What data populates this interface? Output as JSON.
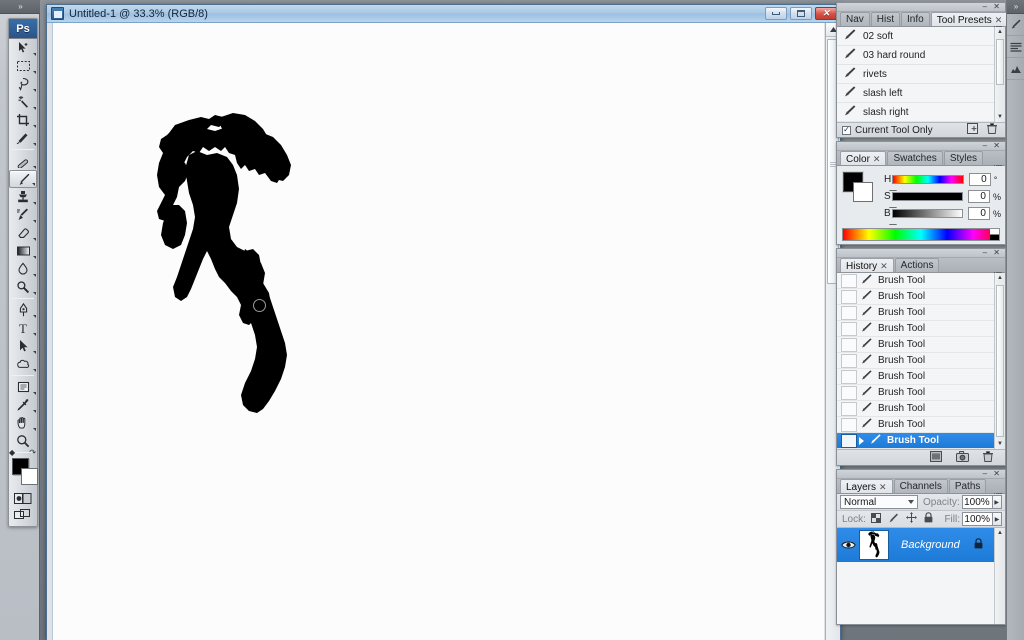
{
  "app": {
    "name": "Adobe Photoshop",
    "logo_text": "Ps",
    "left_rail_collapse": "»",
    "right_rail_collapse": "»"
  },
  "document": {
    "title": "Untitled-1 @ 33.3% (RGB/8)",
    "zoom": "33.3%",
    "color_mode": "RGB/8",
    "window_buttons": {
      "minimize": "–",
      "maximize": "□",
      "close": "✕"
    },
    "canvas_background": "#ffffff",
    "artwork_color": "#000000",
    "artwork_description": "black silhouette of running armored figure"
  },
  "toolbox": {
    "tools": [
      {
        "name": "move-tool",
        "label": "Move Tool",
        "selected": false
      },
      {
        "name": "rectangular-marquee-tool",
        "label": "Rectangular Marquee Tool",
        "selected": false
      },
      {
        "name": "lasso-tool",
        "label": "Lasso Tool",
        "selected": false
      },
      {
        "name": "magic-wand-tool",
        "label": "Magic Wand Tool",
        "selected": false
      },
      {
        "name": "crop-tool",
        "label": "Crop Tool",
        "selected": false
      },
      {
        "name": "slice-tool",
        "label": "Slice Tool",
        "selected": false
      },
      {
        "name": "healing-brush-tool",
        "label": "Spot Healing Brush Tool",
        "selected": false
      },
      {
        "name": "brush-tool",
        "label": "Brush Tool",
        "selected": true
      },
      {
        "name": "clone-stamp-tool",
        "label": "Clone Stamp Tool",
        "selected": false
      },
      {
        "name": "history-brush-tool",
        "label": "History Brush Tool",
        "selected": false
      },
      {
        "name": "eraser-tool",
        "label": "Eraser Tool",
        "selected": false
      },
      {
        "name": "gradient-tool",
        "label": "Gradient Tool",
        "selected": false
      },
      {
        "name": "blur-tool",
        "label": "Blur Tool",
        "selected": false
      },
      {
        "name": "dodge-tool",
        "label": "Dodge Tool",
        "selected": false
      },
      {
        "name": "pen-tool",
        "label": "Pen Tool",
        "selected": false
      },
      {
        "name": "type-tool",
        "label": "Horizontal Type Tool",
        "selected": false
      },
      {
        "name": "path-selection-tool",
        "label": "Path Selection Tool",
        "selected": false
      },
      {
        "name": "custom-shape-tool",
        "label": "Custom Shape Tool",
        "selected": false
      },
      {
        "name": "notes-tool",
        "label": "Notes Tool",
        "selected": false
      },
      {
        "name": "eyedropper-tool",
        "label": "Eyedropper Tool",
        "selected": false
      },
      {
        "name": "hand-tool",
        "label": "Hand Tool",
        "selected": false
      },
      {
        "name": "zoom-tool",
        "label": "Zoom Tool",
        "selected": false
      }
    ],
    "foreground_color": "#000000",
    "background_color": "#ffffff",
    "quick_mask_label": "Edit in Quick Mask Mode",
    "screen_mode_label": "Change Screen Mode"
  },
  "tool_presets_panel": {
    "tabs": [
      {
        "label": "Nav",
        "active": false
      },
      {
        "label": "Hist",
        "active": false
      },
      {
        "label": "Info",
        "active": false
      },
      {
        "label": "Tool Presets",
        "active": true,
        "closable": true
      }
    ],
    "presets": [
      {
        "label": "02 soft"
      },
      {
        "label": "03 hard round"
      },
      {
        "label": "rivets"
      },
      {
        "label": "slash left"
      },
      {
        "label": "slash right"
      }
    ],
    "current_tool_only": {
      "label": "Current Tool Only",
      "checked": true,
      "check_glyph": "✓"
    },
    "footer_icons": [
      {
        "name": "new-tool-preset-icon"
      },
      {
        "name": "delete-tool-preset-icon"
      }
    ]
  },
  "color_panel": {
    "tabs": [
      {
        "label": "Color",
        "active": true,
        "closable": true
      },
      {
        "label": "Swatches",
        "active": false
      },
      {
        "label": "Styles",
        "active": false
      }
    ],
    "foreground_color": "#000000",
    "background_color": "#ffffff",
    "sliders": [
      {
        "label": "H",
        "value": "0",
        "unit": "°"
      },
      {
        "label": "S",
        "value": "0",
        "unit": "%"
      },
      {
        "label": "B",
        "value": "0",
        "unit": "%"
      }
    ]
  },
  "history_panel": {
    "tabs": [
      {
        "label": "History",
        "active": true,
        "closable": true
      },
      {
        "label": "Actions",
        "active": false
      }
    ],
    "states": [
      {
        "label": "Brush Tool",
        "selected": false
      },
      {
        "label": "Brush Tool",
        "selected": false
      },
      {
        "label": "Brush Tool",
        "selected": false
      },
      {
        "label": "Brush Tool",
        "selected": false
      },
      {
        "label": "Brush Tool",
        "selected": false
      },
      {
        "label": "Brush Tool",
        "selected": false
      },
      {
        "label": "Brush Tool",
        "selected": false
      },
      {
        "label": "Brush Tool",
        "selected": false
      },
      {
        "label": "Brush Tool",
        "selected": false
      },
      {
        "label": "Brush Tool",
        "selected": false
      },
      {
        "label": "Brush Tool",
        "selected": true
      }
    ],
    "footer_icons": [
      {
        "name": "new-document-from-state-icon"
      },
      {
        "name": "new-snapshot-icon"
      },
      {
        "name": "delete-state-icon"
      }
    ]
  },
  "layers_panel": {
    "tabs": [
      {
        "label": "Layers",
        "active": true,
        "closable": true
      },
      {
        "label": "Channels",
        "active": false
      },
      {
        "label": "Paths",
        "active": false
      }
    ],
    "blend_mode": "Normal",
    "opacity_label": "Opacity:",
    "opacity_value": "100%",
    "lock_label": "Lock:",
    "fill_label": "Fill:",
    "fill_value": "100%",
    "lock_icons": [
      {
        "name": "lock-transparent-pixels-icon"
      },
      {
        "name": "lock-image-pixels-icon"
      },
      {
        "name": "lock-position-icon"
      },
      {
        "name": "lock-all-icon"
      }
    ],
    "layers": [
      {
        "name": "Background",
        "selected": true,
        "visible": true,
        "locked": true
      }
    ]
  }
}
